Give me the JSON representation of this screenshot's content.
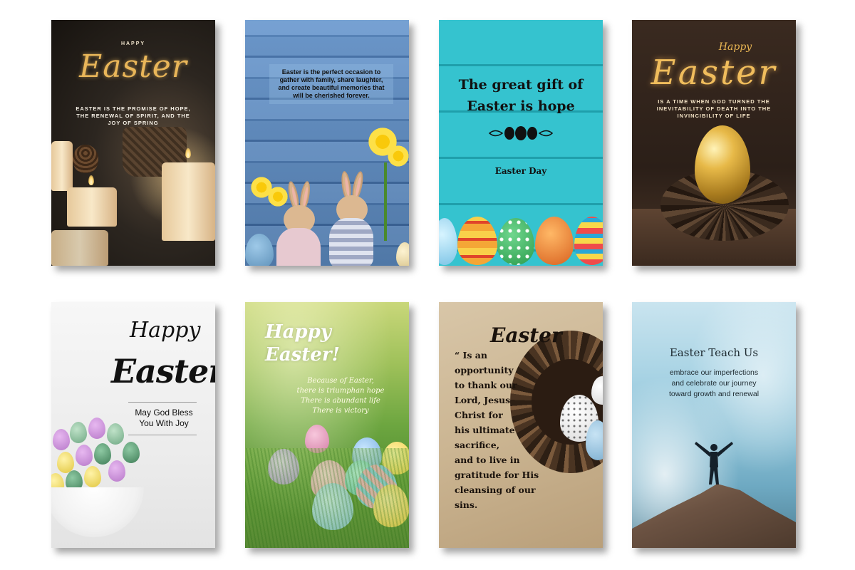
{
  "cards": {
    "c1": {
      "small_title": "HAPPY",
      "script_title": "Easter",
      "body": "EASTER IS THE PROMISE OF HOPE, THE RENEWAL OF SPIRIT, AND THE JOY OF SPRING"
    },
    "c2": {
      "body": "Easter is the perfect occasion to gather with family, share laughter, and create beautiful memories that will be cherished forever."
    },
    "c3": {
      "title_line1": "The great gift of",
      "title_line2": "Easter is hope",
      "subtitle": "Easter Day"
    },
    "c4": {
      "small_script": "Happy",
      "script_title": "Easter",
      "body": "IS A TIME WHEN GOD TURNED THE INEVITABILITY OF DEATH INTO THE INVINCIBILITY OF LIFE"
    },
    "c5": {
      "happy": "Happy",
      "easter": "Easter",
      "blessing_line1": "May God Bless",
      "blessing_line2": "You With Joy"
    },
    "c6": {
      "happy_line1": "Happy",
      "happy_line2": "Easter!",
      "body_line1": "Because of Easter,",
      "body_line2": "there is triumphan hope",
      "body_line3": "There is abundant life",
      "body_line4": "There is victory"
    },
    "c7": {
      "title": "Easter",
      "body_lines": [
        "“ Is an",
        "opportunity",
        "to thank our",
        "Lord, Jesus",
        "Christ for",
        "his ultimate",
        "sacrifice,",
        "and to live in",
        "gratitude for His",
        "cleansing of our sins."
      ]
    },
    "c8": {
      "title": "Easter Teach Us",
      "body_line1": "embrace our imperfections",
      "body_line2": "and celebrate our journey",
      "body_line3": "toward growth and renewal"
    }
  },
  "colors": {
    "gold": "#e9b659",
    "turquoise": "#35c3cf",
    "kraft": "#cbb592",
    "sky": "#a8d3e4"
  }
}
